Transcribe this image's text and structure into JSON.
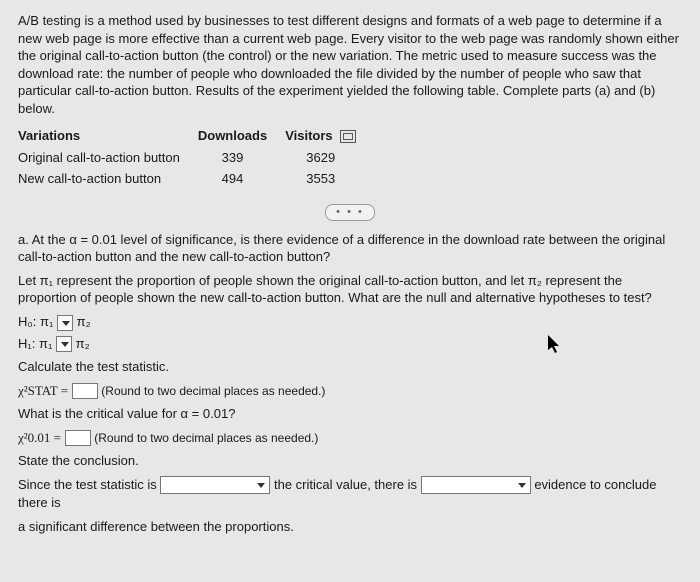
{
  "intro": "A/B testing is a method used by businesses to test different designs and formats of a web page to determine if a new web page is more effective than a current web page. Every visitor to the web page was randomly shown either the original call-to-action button (the control) or the new variation. The metric used to measure success was the download rate: the number of people who downloaded the file divided by the number of people who saw that particular call-to-action button. Results of the experiment yielded the following table. Complete parts (a) and (b) below.",
  "table": {
    "headers": {
      "c0": "Variations",
      "c1": "Downloads",
      "c2": "Visitors"
    },
    "rows": [
      {
        "c0": "Original call-to-action button",
        "c1": "339",
        "c2": "3629"
      },
      {
        "c0": "New call-to-action button",
        "c1": "494",
        "c2": "3553"
      }
    ]
  },
  "ellipsis": "• • •",
  "partA": {
    "q": "a. At the α = 0.01 level of significance, is there evidence of a difference in the download rate between the original call-to-action button and the new call-to-action button?",
    "defs": "Let π₁ represent the proportion of people shown the original call-to-action button, and let π₂ represent the proportion of people shown the new call-to-action button. What are the null and alternative hypotheses to test?",
    "h0_left": "H₀: π₁",
    "h0_right": "π₂",
    "h1_left": "H₁: π₁",
    "h1_right": "π₂",
    "calc": "Calculate the test statistic.",
    "stat_left": "χ²STAT =",
    "round_note": "(Round to two decimal places as needed.)",
    "crit_q": "What is the critical value for α = 0.01?",
    "crit_left": "χ²0.01 =",
    "state": "State the conclusion.",
    "concl_a": "Since the test statistic is",
    "concl_b": "the critical value, there is",
    "concl_c": "evidence to conclude there is",
    "concl_d": "a significant difference between the proportions."
  }
}
